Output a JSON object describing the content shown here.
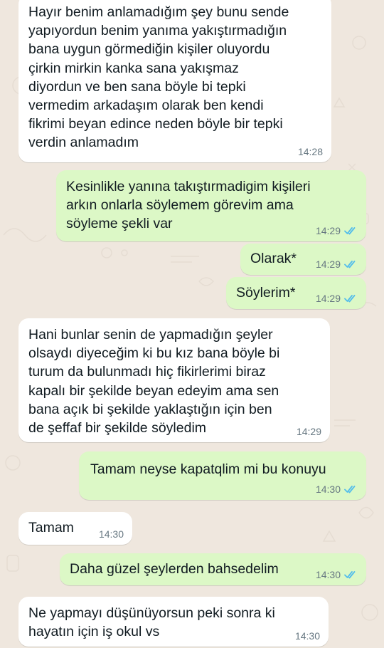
{
  "colors": {
    "wallpaper": "#efe7de",
    "incoming_bubble": "#ffffff",
    "outgoing_bubble": "#dcf8c6",
    "timestamp": "#667781",
    "read_ticks": "#53bdeb"
  },
  "messages": [
    {
      "direction": "incoming",
      "text": "Hayır benim anlamadığım şey bunu sende\nyapıyordun benim yanıma yakıştırmadığın\nbana uygun görmediğin kişiler oluyordu\nçirkin mirkin kanka sana yakışmaz\ndiyordun ve ben sana böyle bi tepki\nvermedim arkadaşım olarak ben kendi\nfikrimi beyan edince neden böyle bir tepki\nverdin anlamadım",
      "time": "14:28"
    },
    {
      "direction": "outgoing",
      "text": "Kesinlikle yanına takıştırmadigim kişileri\narkın onlarla söylemem görevim ama\nsöyleme şekli var",
      "time": "14:29",
      "status": "read"
    },
    {
      "direction": "outgoing",
      "text": "Olarak*",
      "time": "14:29",
      "status": "read"
    },
    {
      "direction": "outgoing",
      "text": "Söylerim*",
      "time": "14:29",
      "status": "read"
    },
    {
      "direction": "incoming",
      "text": "Hani bunlar senin de yapmadığın şeyler\nolsaydı diyeceğim ki bu kız bana böyle bi\nturum da bulunmadı hiç fikirlerimi biraz\nkapalı bir şekilde beyan edeyim ama sen\nbana açık bi şekilde yaklaştığın için ben\nde şeffaf bir şekilde söyledim",
      "time": "14:29"
    },
    {
      "direction": "outgoing",
      "text": "Tamam neyse kapatqlim mi bu konuyu",
      "time": "14:30",
      "status": "read"
    },
    {
      "direction": "incoming",
      "text": "Tamam",
      "time": "14:30"
    },
    {
      "direction": "outgoing",
      "text": "Daha güzel şeylerden bahsedelim",
      "time": "14:30",
      "status": "read"
    },
    {
      "direction": "incoming",
      "text": "Ne yapmayı düşünüyorsun peki sonra ki\nhayatın için iş okul vs",
      "time": "14:30"
    }
  ]
}
